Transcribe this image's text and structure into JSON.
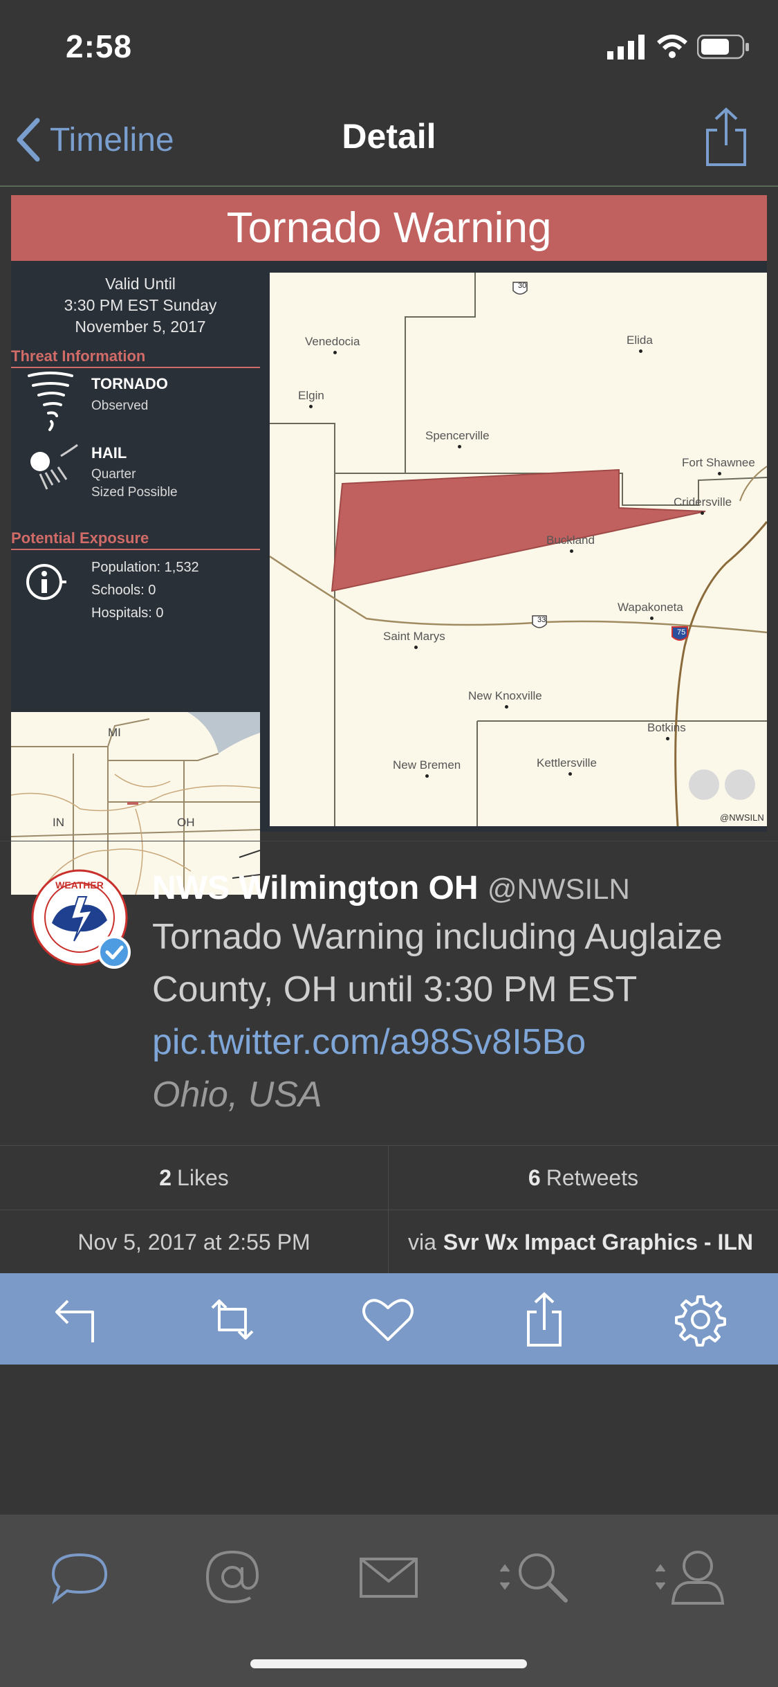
{
  "status_bar": {
    "time": "2:58"
  },
  "nav": {
    "back_label": "Timeline",
    "title": "Detail"
  },
  "image": {
    "banner": "Tornado Warning",
    "valid_until": [
      "Valid Until",
      "3:30 PM EST Sunday",
      "November 5, 2017"
    ],
    "threat_header": "Threat Information",
    "threats": [
      {
        "title": "TORNADO",
        "sub": [
          "Observed"
        ]
      },
      {
        "title": "HAIL",
        "sub": [
          "Quarter",
          "Sized Possible"
        ]
      }
    ],
    "exposure_header": "Potential Exposure",
    "exposure": [
      "Population: 1,532",
      "Schools: 0",
      "Hospitals: 0"
    ],
    "mini_map_labels": [
      "MI",
      "IN",
      "OH"
    ],
    "towns": [
      "Venedocia",
      "Elida",
      "Elgin",
      "Spencerville",
      "Fort Shawnee",
      "Cridersville",
      "Buckland",
      "Wapakoneta",
      "Saint Marys",
      "New Knoxville",
      "Botkins",
      "New Bremen",
      "Kettlersville"
    ],
    "route_shields": [
      "30",
      "33",
      "75"
    ],
    "credit": "@NWSILN"
  },
  "tweet": {
    "name": "NWS Wilmington OH",
    "handle": "@NWSILN",
    "text": "Tornado Warning including Auglaize County, OH until 3:30 PM EST ",
    "link": "pic.twitter.com/a98Sv8I5Bo",
    "location": "Ohio, USA",
    "avatar_text": "NATIONAL WEATHER SERVICE"
  },
  "stats": {
    "likes_count": "2",
    "likes_label": "Likes",
    "retweets_count": "6",
    "retweets_label": "Retweets",
    "date": "Nov 5, 2017 at 2:55 PM",
    "via_prefix": "via",
    "via_source": "Svr Wx Impact Graphics - ILN"
  },
  "icons": {
    "action_bar": [
      "reply-icon",
      "retweet-icon",
      "like-icon",
      "share-icon",
      "settings-icon"
    ],
    "tab_bar": [
      "timeline-icon",
      "mentions-icon",
      "messages-icon",
      "search-icon",
      "profile-icon"
    ]
  },
  "colors": {
    "accent": "#7b9ac8",
    "banner": "#c0615f",
    "link": "#7fa6d8",
    "background": "#363636"
  }
}
